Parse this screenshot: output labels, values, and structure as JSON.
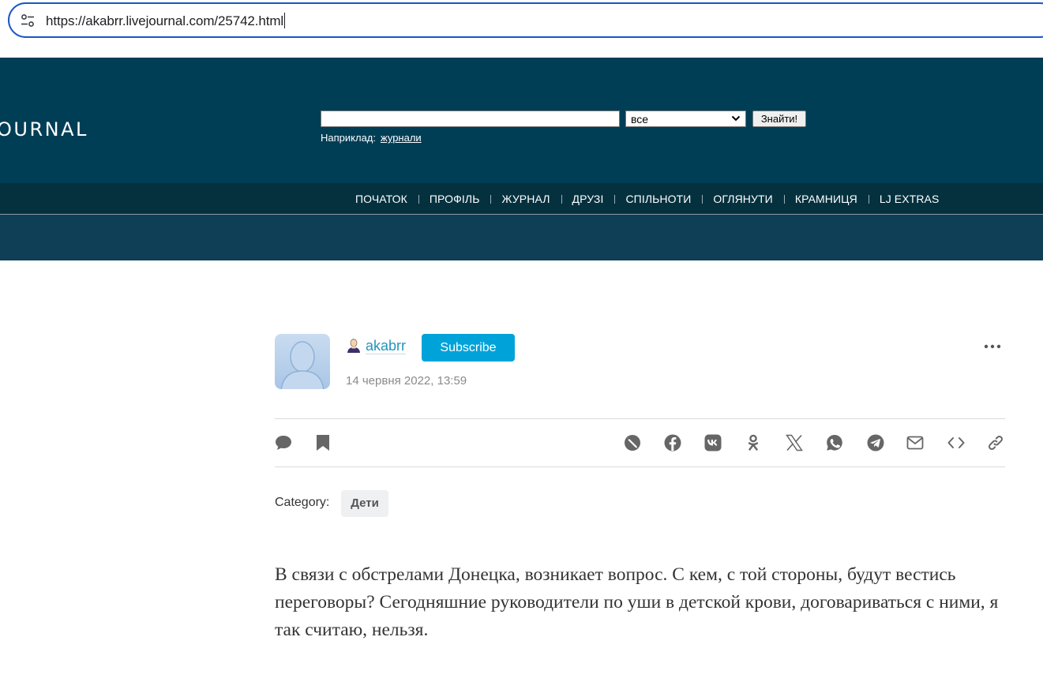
{
  "browser": {
    "url": "https://akabrr.livejournal.com/25742.html"
  },
  "header": {
    "logo": "OURNAL",
    "search": {
      "value": "",
      "scope_selected": "все",
      "button_label": "Знайти!",
      "example_prefix": "Наприклад:",
      "example_link": "журнали"
    }
  },
  "nav": {
    "items": [
      {
        "label": "ПОЧАТОК"
      },
      {
        "label": "ПРОФІЛЬ"
      },
      {
        "label": "ЖУРНАЛ"
      },
      {
        "label": "ДРУЗІ"
      },
      {
        "label": "СПІЛЬНОТИ"
      },
      {
        "label": "ОГЛЯНУТИ"
      },
      {
        "label": "КРАМНИЦЯ"
      },
      {
        "label": "LJ EXTRAS"
      }
    ]
  },
  "post": {
    "author": "akabrr",
    "subscribe_label": "Subscribe",
    "date": "14 червня 2022, 13:59",
    "category_label": "Category:",
    "category_tag": "Дети",
    "body": "В связи с обстрелами Донецка, возникает вопрос. С кем, с той стороны, будут вестись переговоры? Сегодняшние руководители по уши в детской крови, договариваться с ними, я так считаю, нельзя."
  },
  "icons": {
    "left_actions": [
      "comment-icon",
      "bookmark-icon"
    ],
    "share": [
      "livejournal-icon",
      "facebook-icon",
      "vk-icon",
      "odnoklassniki-icon",
      "x-icon",
      "whatsapp-icon",
      "telegram-icon",
      "email-icon",
      "embed-icon",
      "link-icon"
    ]
  },
  "colors": {
    "header_bg": "#003e56",
    "nav_bg": "#05313f",
    "accent": "#00a3d9",
    "link": "#2494b9",
    "icon_gray": "#666666"
  }
}
